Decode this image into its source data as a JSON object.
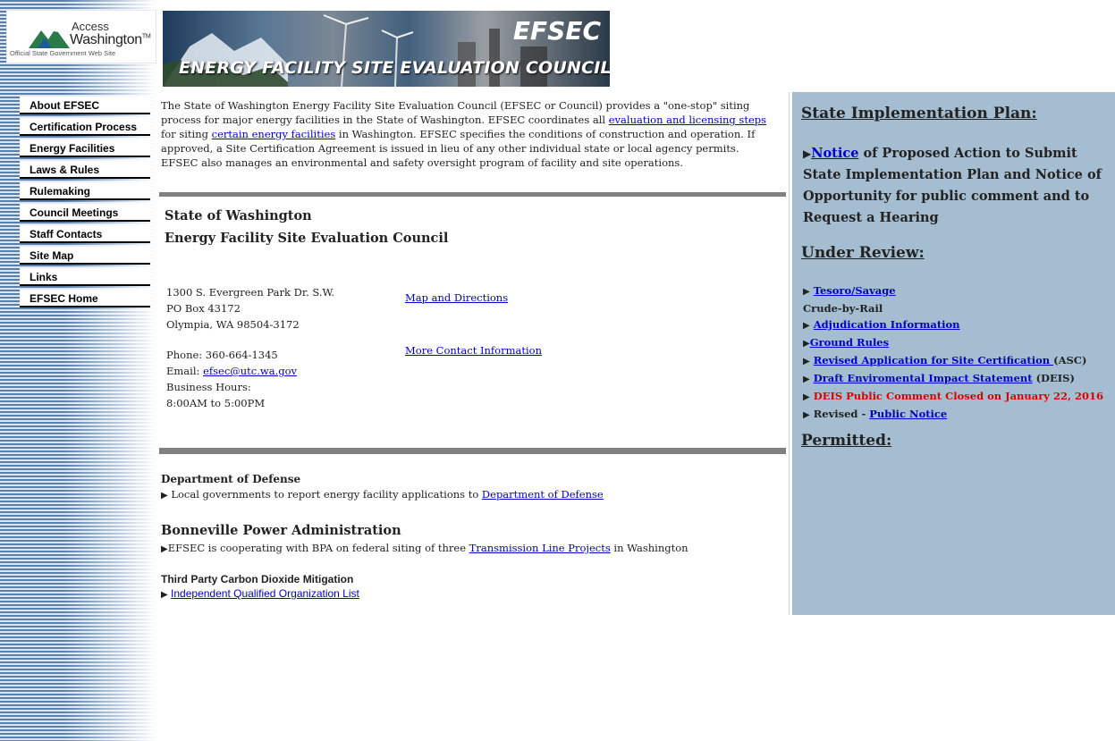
{
  "logo": {
    "line1": "Access",
    "line2": "Washington",
    "tm": "TM",
    "line3": "Official State Government Web Site"
  },
  "banner": {
    "title": "EFSEC",
    "subtitle": "ENERGY FACILITY SITE EVALUATION COUNCIL"
  },
  "nav": {
    "items": [
      {
        "label": "About EFSEC"
      },
      {
        "label": "Certification Process"
      },
      {
        "label": "Energy Facilities"
      },
      {
        "label": "Laws & Rules"
      },
      {
        "label": "Rulemaking"
      },
      {
        "label": "Council Meetings"
      },
      {
        "label": "Staff Contacts"
      },
      {
        "label": "Site Map"
      },
      {
        "label": "Links"
      },
      {
        "label": "EFSEC Home"
      }
    ]
  },
  "intro": {
    "p1": "The State of Washington Energy Facility Site Evaluation Council (EFSEC or Council) provides a \"one-stop\" siting process for major energy facilities in the State of Washington. EFSEC coordinates all ",
    "link1": "evaluation and licensing steps",
    "p2": " for siting ",
    "link2": "certain energy facilities",
    "p3": " in Washington.  EFSEC specifies the conditions of construction and operation. If approved, a Site Certification Agreement is issued in lieu of any other individual state or local agency permits. EFSEC also manages an environmental and safety oversight program of facility and site operations."
  },
  "contact": {
    "heading1": "State of Washington",
    "heading2": "Energy Facility Site Evaluation Council",
    "address1": "1300 S. Evergreen Park Dr. S.W.",
    "address2": "PO Box 43172",
    "address3": "Olympia, WA 98504-3172",
    "phone": "Phone: 360-664-1345",
    "email_label": "Email: ",
    "email": "efsec@utc.wa.gov",
    "hours_label": "Business Hours:",
    "hours": "8:00AM to 5:00PM",
    "map_link": "Map and Directions",
    "more_link": "More Contact Information"
  },
  "sections": {
    "dod_heading": "Department of Defense",
    "dod_text": "Local governments to report energy facility applications to ",
    "dod_link": "Department of Defense",
    "bpa_heading": "Bonneville Power Administration",
    "bpa_text1": "EFSEC is cooperating with BPA on federal siting of three ",
    "bpa_link": "Transmission Line Projects",
    "bpa_text2": " in Washington",
    "carbon_heading": "Third Party Carbon Dioxide Mitigation",
    "carbon_link": "Independent Qualified Organization List"
  },
  "right_panel": {
    "sip_heading": "State Implementation Plan:",
    "notice_link": "Notice",
    "notice_text": " of Proposed Action to Submit State Implementation Plan and Notice of Opportunity for public comment and to Request a Hearing",
    "review_heading": "Under Review:",
    "tesoro_link": "Tesoro/Savage",
    "crude": "Crude-by-Rail",
    "adjudication_link": "Adjudication Information",
    "ground_link": "Ground Rules",
    "asc_link": "Revised Application for Site Certification ",
    "asc_suffix": "(ASC)",
    "deis_link": "Draft Enviromental Impact Statement",
    "deis_suffix": " (DEIS)",
    "deis_closed": "DEIS Public Comment Closed on January 22, 2016",
    "revised_prefix": "Revised - ",
    "public_notice_link": "Public Notice",
    "permitted_heading": "Permitted:"
  },
  "colors": {
    "link": "#0000cc",
    "panel_bg": "#a5bdd0",
    "alert_red": "#e00000",
    "rule_gray": "#808080"
  },
  "icons": {
    "bullet": "right-triangle-icon"
  }
}
